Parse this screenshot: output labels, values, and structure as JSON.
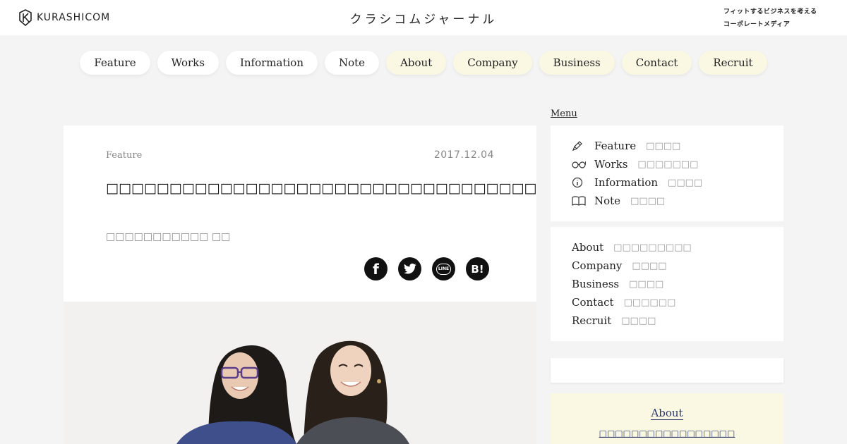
{
  "header": {
    "logo_text": "KURASHICOM",
    "site_title": "クラシコムジャーナル",
    "tagline_line1": "フィットするビジネスを考える",
    "tagline_line2": "コーポレートメディア"
  },
  "nav": {
    "items": [
      {
        "label": "Feature",
        "style": "white"
      },
      {
        "label": "Works",
        "style": "white"
      },
      {
        "label": "Information",
        "style": "white"
      },
      {
        "label": "Note",
        "style": "white"
      },
      {
        "label": "About",
        "style": "cream"
      },
      {
        "label": "Company",
        "style": "cream"
      },
      {
        "label": "Business",
        "style": "cream"
      },
      {
        "label": "Contact",
        "style": "cream"
      },
      {
        "label": "Recruit",
        "style": "cream"
      }
    ]
  },
  "article": {
    "category": "Feature",
    "date": "2017.12.04",
    "title": "□□□□□□□□□□□□□□□□□□□□□□□□□□□□□□□□□□□□□□□□□□□GMO□□□□□□□□□□□□□□□□□□□□□□□□□□□",
    "subtitle": "□□□□□□□□□□□ □□",
    "share": {
      "facebook": "f",
      "line": "LINE",
      "hatena": "B!"
    }
  },
  "sidebar": {
    "menu_label": "Menu",
    "primary": [
      {
        "label": "Feature",
        "jp": "□□□□",
        "icon": "pen-icon"
      },
      {
        "label": "Works",
        "jp": "□□□□□□□",
        "icon": "glasses-icon"
      },
      {
        "label": "Information",
        "jp": "□□□□",
        "icon": "info-icon"
      },
      {
        "label": "Note",
        "jp": "□□□□",
        "icon": "book-icon"
      }
    ],
    "secondary": [
      {
        "label": "About",
        "jp": "□□□□□□□□□"
      },
      {
        "label": "Company",
        "jp": "□□□□"
      },
      {
        "label": "Business",
        "jp": "□□□□"
      },
      {
        "label": "Contact",
        "jp": "□□□□□□"
      },
      {
        "label": "Recruit",
        "jp": "□□□□"
      }
    ],
    "about": {
      "title": "About",
      "text": "□□□□□□□□□□□□□□□□□"
    }
  },
  "colors": {
    "page_bg": "#f4f4f4",
    "cream_pill": "#faf7e3",
    "about_link": "#2c3a6b"
  }
}
